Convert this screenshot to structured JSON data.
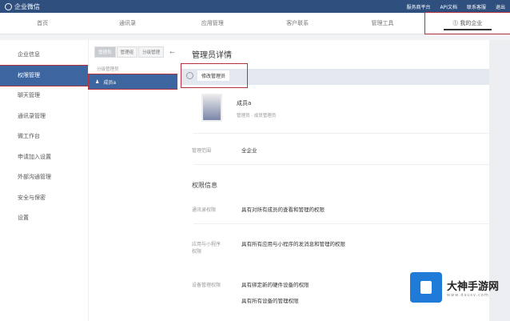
{
  "app": {
    "title": "企业微信",
    "links": [
      "服务商平台",
      "API文档",
      "联系客服",
      "退出"
    ]
  },
  "nav": [
    "首页",
    "通讯录",
    "应用管理",
    "客户联系",
    "管理工具",
    "我的企业"
  ],
  "sidebar": [
    "企业信息",
    "权限管理",
    "聊天管理",
    "通讯录管理",
    "微工作台",
    "申请加入设置",
    "外部沟通管理",
    "安全与保密",
    "设置"
  ],
  "middle": {
    "tabs": [
      "管理员",
      "管理组",
      "分级管理"
    ],
    "group_label": "分级管理员",
    "member": "成员a"
  },
  "main": {
    "title": "管理员详情",
    "edit_button": "修改管理员",
    "member_name": "成员a",
    "member_role": "管理员 · 成员管理员",
    "scope_label": "管理范围",
    "scope_value": "全企业",
    "section": "权限信息",
    "perms": [
      {
        "label": "通讯录权限",
        "values": [
          "具有对所有成员的查看和管理的权限"
        ]
      },
      {
        "label": "应用与小程序权限",
        "values": [
          "具有所有应用与小程序的发消息和管理的权限"
        ]
      },
      {
        "label": "设备管理权限",
        "values": [
          "具有绑定新的硬件设备的权限",
          "具有所有设备的管理权限"
        ]
      }
    ]
  },
  "watermark": {
    "name": "大神手游网",
    "url": "www.dsusv.com"
  }
}
